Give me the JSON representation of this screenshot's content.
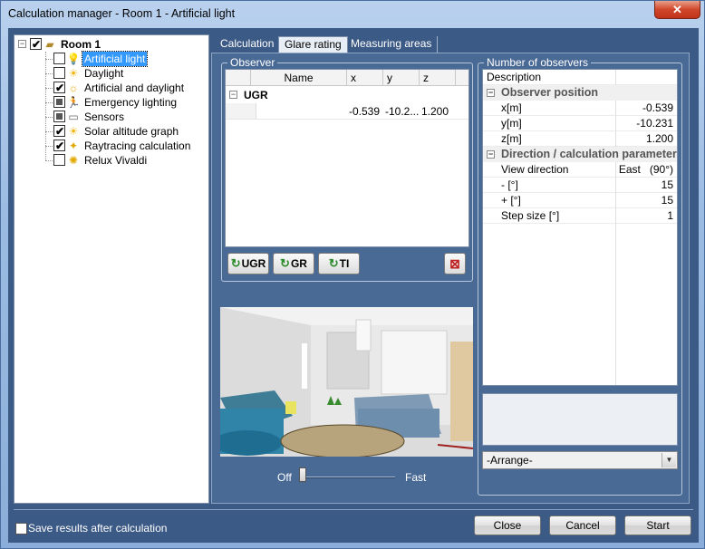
{
  "window": {
    "title": "Calculation manager - Room 1 - Artificial light",
    "close_label": "✕"
  },
  "tree": {
    "root": {
      "label": "Room 1",
      "checked": true
    },
    "items": [
      {
        "label": "Artificial light",
        "checked": false,
        "icon": "bulb-icon",
        "selected": true
      },
      {
        "label": "Daylight",
        "checked": false,
        "icon": "sun-icon"
      },
      {
        "label": "Artificial and daylight",
        "checked": true,
        "icon": "sun-bulb-icon"
      },
      {
        "label": "Emergency lighting",
        "checked": "partial",
        "icon": "exit-person-icon"
      },
      {
        "label": "Sensors",
        "checked": "partial",
        "icon": "sensor-icon"
      },
      {
        "label": "Solar altitude graph",
        "checked": true,
        "icon": "sun-icon"
      },
      {
        "label": "Raytracing calculation",
        "checked": true,
        "icon": "raytrace-icon"
      },
      {
        "label": "Relux Vivaldi",
        "checked": false,
        "icon": "vivaldi-icon"
      }
    ]
  },
  "tabs": [
    {
      "label": "Calculation",
      "active": false
    },
    {
      "label": "Glare rating",
      "active": true
    },
    {
      "label": "Measuring areas",
      "active": false
    }
  ],
  "observer": {
    "group_label": "Observer",
    "columns": [
      "Name",
      "x",
      "y",
      "z"
    ],
    "section": "UGR",
    "rows": [
      {
        "name": "",
        "x": "-0.539",
        "y": "-10.2...",
        "z": "1.200"
      }
    ],
    "buttons": {
      "ugr": "UGR",
      "gr": "GR",
      "ti": "TI"
    }
  },
  "slider": {
    "min_label": "Off",
    "max_label": "Fast",
    "value_fraction": 0.0
  },
  "observers_panel": {
    "group_label": "Number of observers",
    "header": "Description",
    "position_section": "Observer position",
    "position_rows": [
      {
        "label": "x[m]",
        "value": "-0.539"
      },
      {
        "label": "y[m]",
        "value": "-10.231"
      },
      {
        "label": "z[m]",
        "value": "1.200"
      }
    ],
    "direction_section": "Direction / calculation parameter",
    "direction_rows": [
      {
        "label": "View direction",
        "value": "East   (90°)"
      },
      {
        "label": "- [°]",
        "value": "15"
      },
      {
        "label": "+ [°]",
        "value": "15"
      },
      {
        "label": "Step size [°]",
        "value": "1"
      }
    ],
    "arrange_selected": "-Arrange-"
  },
  "footer": {
    "save_label": "Save results after calculation",
    "save_checked": false,
    "close_label": "Close",
    "cancel_label": "Cancel",
    "start_label": "Start"
  }
}
